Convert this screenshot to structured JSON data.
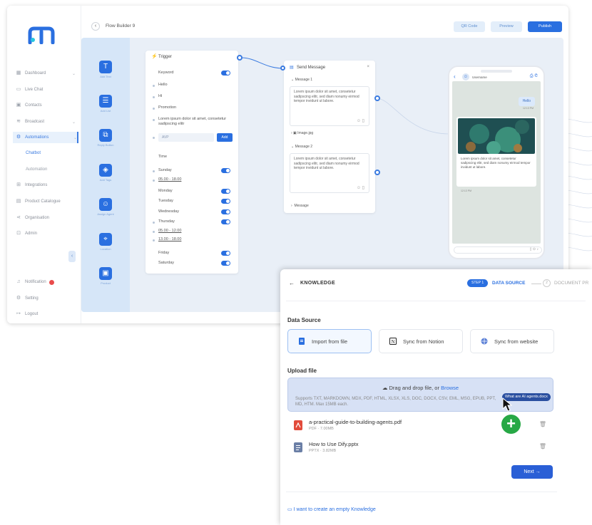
{
  "flow_builder": {
    "title": "Flow Builder 9",
    "buttons": {
      "qr_code": "QR Code",
      "preview": "Preview",
      "publish": "Publish"
    },
    "sidebar": [
      {
        "label": "Dashboard",
        "icon": "grid-icon"
      },
      {
        "label": "Live Chat",
        "icon": "chat-icon"
      },
      {
        "label": "Contacts",
        "icon": "contacts-icon"
      },
      {
        "label": "Broadcast",
        "icon": "broadcast-icon"
      },
      {
        "label": "Automations",
        "icon": "automation-icon"
      },
      {
        "label": "Chatbot",
        "icon": ""
      },
      {
        "label": "Automation",
        "icon": ""
      },
      {
        "label": "Integrations",
        "icon": "integrations-icon"
      },
      {
        "label": "Product Catalogue",
        "icon": "catalogue-icon"
      },
      {
        "label": "Organisation",
        "icon": "organisation-icon"
      },
      {
        "label": "Admin",
        "icon": "admin-icon"
      },
      {
        "label": "Notification",
        "icon": "bell-icon"
      },
      {
        "label": "Setting",
        "icon": "gear-icon"
      },
      {
        "label": "Logout",
        "icon": "logout-icon"
      }
    ],
    "tools": [
      {
        "label": "Add Text",
        "icon": "text-icon"
      },
      {
        "label": "Add List",
        "icon": "list-icon"
      },
      {
        "label": "Reply Button",
        "icon": "reply-icon"
      },
      {
        "label": "Add Tags",
        "icon": "tag-icon"
      },
      {
        "label": "Assign Agent",
        "icon": "agent-icon"
      },
      {
        "label": "Location",
        "icon": "location-icon"
      },
      {
        "label": "Product",
        "icon": "product-icon"
      }
    ],
    "trigger": {
      "title": "Trigger",
      "keyword_label": "Keyword",
      "keywords": [
        "Hello",
        "Hi",
        "Promotion",
        "Lorem ipsum dolor sit amet, consetetur sadipscing elitr"
      ],
      "add_placeholder": "AVP",
      "add_button": "Add",
      "time_label": "Time",
      "days": [
        {
          "day": "Sunday",
          "times": [
            "05.00 - 18.00"
          ],
          "on": true
        },
        {
          "day": "Monday",
          "times": [],
          "on": true
        },
        {
          "day": "Tuesday",
          "times": [],
          "on": true
        },
        {
          "day": "Wednesday",
          "times": [],
          "on": true
        },
        {
          "day": "Thursday",
          "times": [
            "05.00 - 12.00",
            "13.00 - 18.00"
          ],
          "on": true
        },
        {
          "day": "Friday",
          "times": [],
          "on": true
        },
        {
          "day": "Saturday",
          "times": [],
          "on": true
        }
      ]
    },
    "send_message": {
      "title": "Send Message",
      "message1_label": "Message 1",
      "message1_text": "Lorem ipsum dolor sit amet, consetetur sadipscing elitr, sed diam nonumy eirmod tempor invidunt ut labore.",
      "image_label": "Image.jpg",
      "message2_label": "Message 2",
      "message2_text": "Lorem ipsum dolor sit amet, consetetur sadipscing elitr, sed diam nonumy eirmod tempor invidunt ut labore.",
      "message3_label": "Message"
    },
    "phone": {
      "username": "Username",
      "hello": "Hello",
      "hello_time": "12:13 PM",
      "reply_text": "Lorem ipsum dolor sit amet, consetetur sadipscing elitr, sed diam nonumy eirmod tempor invidunt ut labore.",
      "reply_time": "12:13 PM"
    }
  },
  "knowledge": {
    "title": "KNOWLEDGE",
    "step1_pill": "STEP 1",
    "step1_label": "DATA SOURCE",
    "step2_num": "2",
    "step2_label": "DOCUMENT PR",
    "data_source_label": "Data Source",
    "sources": [
      "Import from file",
      "Sync from Notion",
      "Sync from website"
    ],
    "upload_label": "Upload file",
    "drop_text": "Drag and drop file, or ",
    "drop_browse": "Browse",
    "drop_support": "Supports TXT, MARKDOWN, MDX, PDF, HTML, XLSX, XLS, DOC, DOCX, CSV, EML, MSG, EPUB, PPT, MD, HTM. Max 15MB each.",
    "tooltip": "What are AI agents.docx",
    "files": [
      {
        "name": "a-practical-guide-to-building-agents.pdf",
        "meta": "PDF · 7.00MB",
        "color": "#e24b3b"
      },
      {
        "name": "How to Use Dify.pptx",
        "meta": "PPTX · 3.82MB",
        "color": "#6b7fa6"
      }
    ],
    "next_button": "Next →",
    "empty_link": "I want to create an empty Knowledge"
  }
}
